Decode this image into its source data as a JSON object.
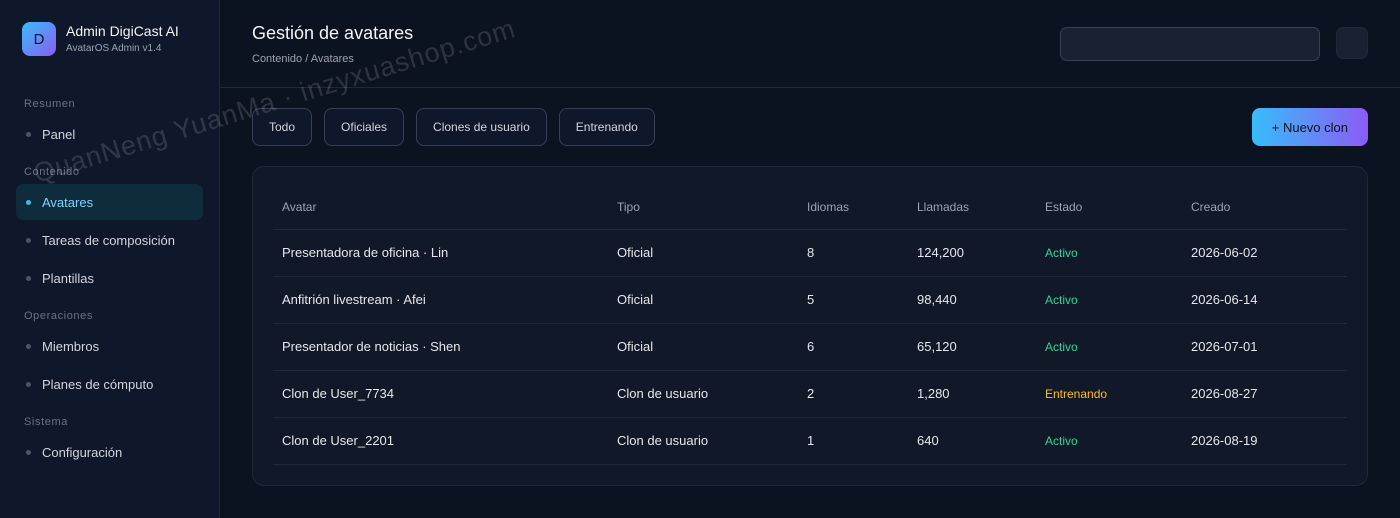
{
  "brand": {
    "logo_letter": "D",
    "name": "Admin DigiCast AI",
    "subtitle": "AvatarOS Admin v1.4"
  },
  "sidebar": {
    "groups": [
      {
        "label": "Resumen",
        "items": [
          {
            "label": "Panel",
            "active": false
          }
        ]
      },
      {
        "label": "Contenido",
        "items": [
          {
            "label": "Avatares",
            "active": true
          },
          {
            "label": "Tareas de composición",
            "active": false
          },
          {
            "label": "Plantillas",
            "active": false
          }
        ]
      },
      {
        "label": "Operaciones",
        "items": [
          {
            "label": "Miembros",
            "active": false
          },
          {
            "label": "Planes de cómputo",
            "active": false
          }
        ]
      },
      {
        "label": "Sistema",
        "items": [
          {
            "label": "Configuración",
            "active": false
          }
        ]
      }
    ]
  },
  "header": {
    "title": "Gestión de avatares",
    "breadcrumb": "Contenido / Avatares",
    "search_value": ""
  },
  "toolbar": {
    "filters": [
      "Todo",
      "Oficiales",
      "Clones de usuario",
      "Entrenando"
    ],
    "new_button": "+ Nuevo clon"
  },
  "table": {
    "columns": [
      "Avatar",
      "Tipo",
      "Idiomas",
      "Llamadas",
      "Estado",
      "Creado"
    ],
    "rows": [
      {
        "avatar": "Presentadora de oficina · Lin",
        "tipo": "Oficial",
        "idiomas": "8",
        "llamadas": "124,200",
        "estado": "Activo",
        "creado": "2026-06-02"
      },
      {
        "avatar": "Anfitrión livestream · Afei",
        "tipo": "Oficial",
        "idiomas": "5",
        "llamadas": "98,440",
        "estado": "Activo",
        "creado": "2026-06-14"
      },
      {
        "avatar": "Presentador de noticias · Shen",
        "tipo": "Oficial",
        "idiomas": "6",
        "llamadas": "65,120",
        "estado": "Activo",
        "creado": "2026-07-01"
      },
      {
        "avatar": "Clon de User_7734",
        "tipo": "Clon de usuario",
        "idiomas": "2",
        "llamadas": "1,280",
        "estado": "Entrenando",
        "creado": "2026-08-27"
      },
      {
        "avatar": "Clon de User_2201",
        "tipo": "Clon de usuario",
        "idiomas": "1",
        "llamadas": "640",
        "estado": "Activo",
        "creado": "2026-08-19"
      }
    ]
  },
  "colors": {
    "accent": "#38bdf8",
    "accent_secondary": "#8b5cf6",
    "status_active": "#34d399",
    "status_training": "#fbbf24",
    "background": "#0b1220"
  },
  "watermark": "QuanNeng YuanMa · inzyxuashop.com"
}
